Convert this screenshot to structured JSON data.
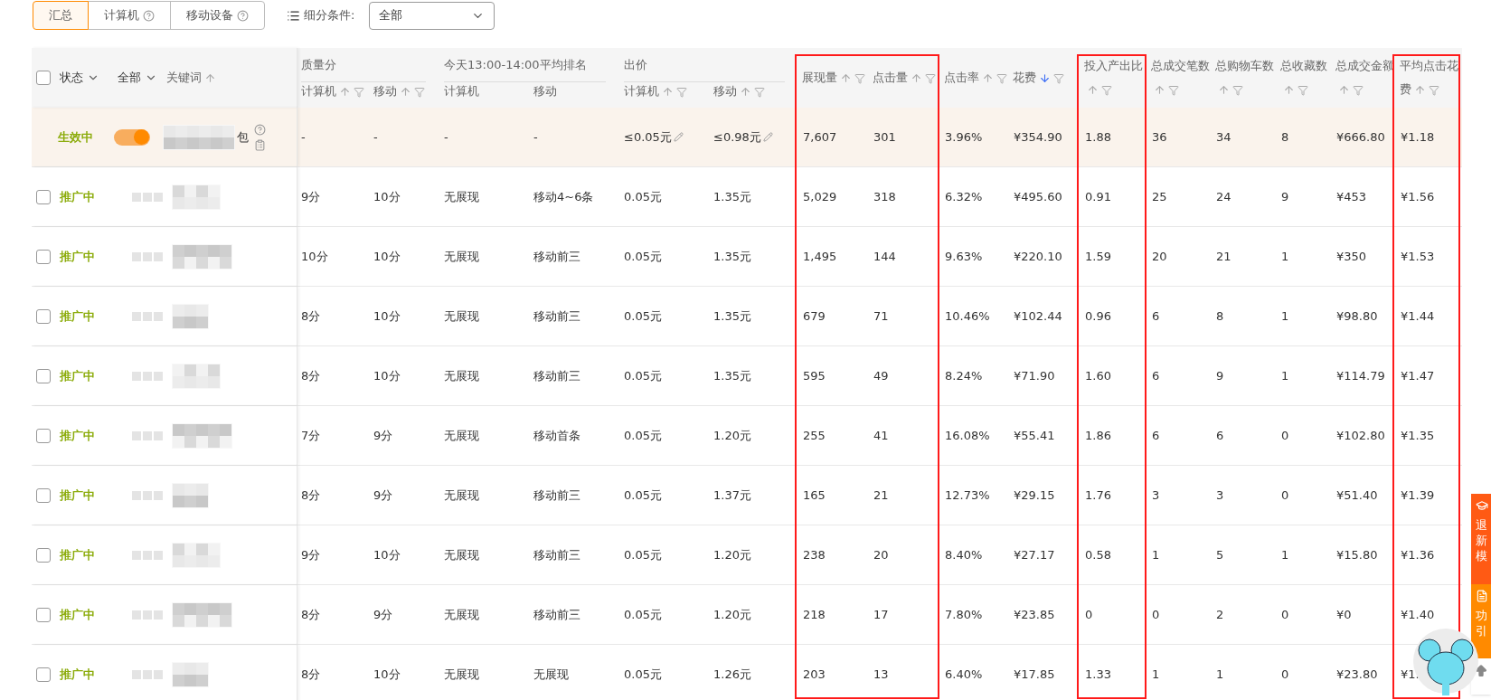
{
  "toolbar": {
    "tabs": [
      {
        "label": "汇总",
        "help": false,
        "selected": true
      },
      {
        "label": "计算机",
        "help": true,
        "selected": false
      },
      {
        "label": "移动设备",
        "help": true,
        "selected": false
      }
    ],
    "filter_label": "细分条件:",
    "filter_value": "全部"
  },
  "table": {
    "header": {
      "select_all_checked": false,
      "status": "状态",
      "scope": "全部",
      "keyword": "关键词",
      "keyword_sortable": true
    },
    "metric_header": [
      {
        "kind": "group",
        "label": "质量分",
        "columns": [
          {
            "label": "计算机",
            "sortable": true,
            "filter": true
          },
          {
            "label": "移动",
            "sortable": true,
            "filter": true
          }
        ]
      },
      {
        "kind": "group",
        "label": "今天13:00-14:00平均排名",
        "columns": [
          {
            "label": "计算机",
            "sortable": false,
            "filter": false
          },
          {
            "label": "移动",
            "sortable": false,
            "filter": false
          }
        ]
      },
      {
        "kind": "group",
        "label": "出价",
        "columns": [
          {
            "label": "计算机",
            "sortable": true,
            "filter": true
          },
          {
            "label": "移动",
            "sortable": true,
            "filter": true
          }
        ]
      },
      {
        "kind": "single",
        "label": "展现量",
        "sortable": true,
        "descending": false,
        "filter": true,
        "highlighted": true
      },
      {
        "kind": "single",
        "label": "点击量",
        "sortable": true,
        "descending": false,
        "filter": true,
        "highlighted": true
      },
      {
        "kind": "single",
        "label": "点击率",
        "sortable": true,
        "descending": false,
        "filter": true,
        "highlighted": false
      },
      {
        "kind": "single",
        "label": "花费",
        "sortable": true,
        "descending": true,
        "filter": true,
        "highlighted": false
      },
      {
        "kind": "single",
        "label": "投入产出比",
        "sortable": true,
        "descending": false,
        "filter": true,
        "highlighted": true
      },
      {
        "kind": "single",
        "label": "总成交笔数",
        "sortable": true,
        "descending": false,
        "filter": true,
        "highlighted": false
      },
      {
        "kind": "single",
        "label": "总购物车数",
        "sortable": true,
        "descending": false,
        "filter": true,
        "highlighted": false
      },
      {
        "kind": "single",
        "label": "总收藏数",
        "sortable": true,
        "descending": false,
        "filter": true,
        "highlighted": false
      },
      {
        "kind": "single",
        "label": "总成交金额",
        "sortable": true,
        "descending": false,
        "filter": true,
        "highlighted": false
      },
      {
        "kind": "single",
        "label": "平均点击花费",
        "sortable": true,
        "descending": false,
        "filter": true,
        "highlighted": true
      }
    ],
    "rows": [
      {
        "kind": "summary",
        "status": "生效中",
        "on": true,
        "keyword_tail": "包",
        "cells": [
          "-",
          "-",
          "-",
          "-",
          "≤0.05元",
          "≤0.98元",
          "7,607",
          "301",
          "3.96%",
          "¥354.90",
          "1.88",
          "36",
          "34",
          "8",
          "¥666.80",
          "¥1.18"
        ]
      },
      {
        "kind": "item",
        "checked": false,
        "status": "推广中",
        "cells": [
          "9分",
          "10分",
          "无展现",
          "移动4~6条",
          "0.05元",
          "1.35元",
          "5,029",
          "318",
          "6.32%",
          "¥495.60",
          "0.91",
          "25",
          "24",
          "9",
          "¥453",
          "¥1.56"
        ]
      },
      {
        "kind": "item",
        "checked": false,
        "status": "推广中",
        "cells": [
          "10分",
          "10分",
          "无展现",
          "移动前三",
          "0.05元",
          "1.35元",
          "1,495",
          "144",
          "9.63%",
          "¥220.10",
          "1.59",
          "20",
          "21",
          "1",
          "¥350",
          "¥1.53"
        ]
      },
      {
        "kind": "item",
        "checked": false,
        "status": "推广中",
        "cells": [
          "8分",
          "10分",
          "无展现",
          "移动前三",
          "0.05元",
          "1.35元",
          "679",
          "71",
          "10.46%",
          "¥102.44",
          "0.96",
          "6",
          "8",
          "1",
          "¥98.80",
          "¥1.44"
        ]
      },
      {
        "kind": "item",
        "checked": false,
        "status": "推广中",
        "cells": [
          "8分",
          "10分",
          "无展现",
          "移动前三",
          "0.05元",
          "1.35元",
          "595",
          "49",
          "8.24%",
          "¥71.90",
          "1.60",
          "6",
          "9",
          "1",
          "¥114.79",
          "¥1.47"
        ]
      },
      {
        "kind": "item",
        "checked": false,
        "status": "推广中",
        "cells": [
          "7分",
          "9分",
          "无展现",
          "移动首条",
          "0.05元",
          "1.20元",
          "255",
          "41",
          "16.08%",
          "¥55.41",
          "1.86",
          "6",
          "6",
          "0",
          "¥102.80",
          "¥1.35"
        ]
      },
      {
        "kind": "item",
        "checked": false,
        "status": "推广中",
        "cells": [
          "8分",
          "9分",
          "无展现",
          "移动前三",
          "0.05元",
          "1.37元",
          "165",
          "21",
          "12.73%",
          "¥29.15",
          "1.76",
          "3",
          "3",
          "0",
          "¥51.40",
          "¥1.39"
        ]
      },
      {
        "kind": "item",
        "checked": false,
        "status": "推广中",
        "cells": [
          "9分",
          "10分",
          "无展现",
          "移动前三",
          "0.05元",
          "1.20元",
          "238",
          "20",
          "8.40%",
          "¥27.17",
          "0.58",
          "1",
          "5",
          "1",
          "¥15.80",
          "¥1.36"
        ]
      },
      {
        "kind": "item",
        "checked": false,
        "status": "推广中",
        "cells": [
          "8分",
          "9分",
          "无展现",
          "移动前三",
          "0.05元",
          "1.20元",
          "218",
          "17",
          "7.80%",
          "¥23.85",
          "0",
          "0",
          "2",
          "0",
          "¥0",
          "¥1.40"
        ]
      },
      {
        "kind": "item",
        "checked": false,
        "status": "推广中",
        "cells": [
          "8分",
          "10分",
          "无展现",
          "无展现",
          "0.05元",
          "1.26元",
          "203",
          "13",
          "6.40%",
          "¥17.85",
          "1.33",
          "1",
          "1",
          "0",
          "¥23.80",
          "¥1."
        ]
      }
    ]
  },
  "side_panel": {
    "items": [
      {
        "kind": "cap",
        "lines": [
          "退",
          "新",
          "模"
        ]
      },
      {
        "kind": "doc",
        "lines": [
          "功",
          "引"
        ]
      }
    ]
  }
}
